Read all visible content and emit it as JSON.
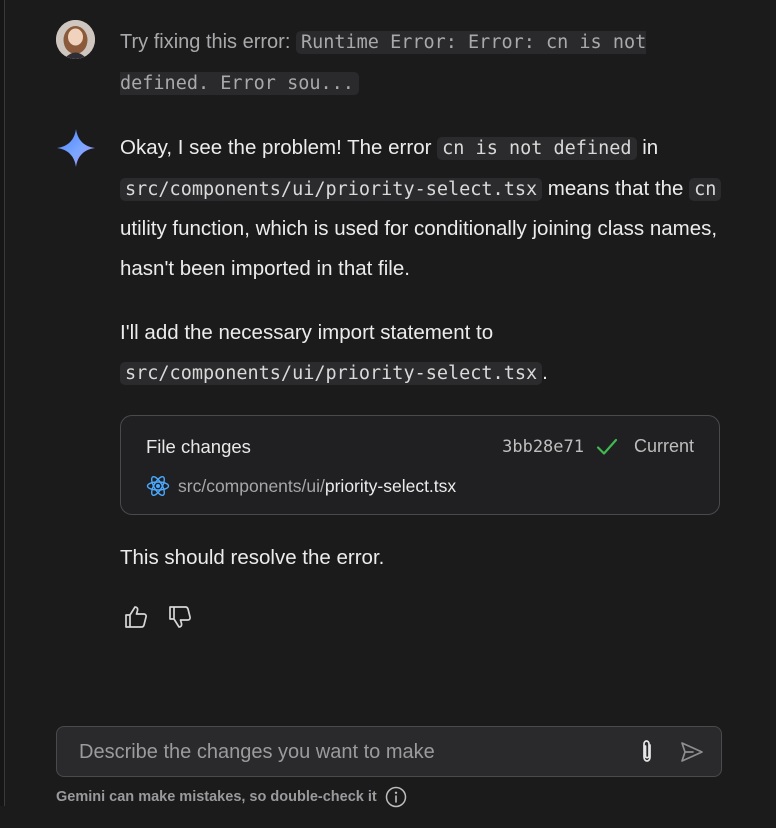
{
  "user_message": {
    "prefix": "Try fixing this error:",
    "code": "Runtime Error: Error: cn is not defined. Error sou..."
  },
  "assistant": {
    "p1": {
      "t1": "Okay, I see the problem! The error ",
      "c1": "cn is not defined",
      "t2": " in ",
      "c2": "src/components/ui/priority-select.tsx",
      "t3": " means that the ",
      "c3": "cn",
      "t4": " utility function, which is used for conditionally joining class names, hasn't been imported in that file."
    },
    "p2": {
      "t1": "I'll add the necessary import statement to ",
      "c1": "src/components/ui/priority-select.tsx",
      "t2": "."
    },
    "file_changes": {
      "title": "File changes",
      "hash": "3bb28e71",
      "status": "Current",
      "path_dir": "src/components/ui/",
      "path_name": "priority-select.tsx"
    },
    "closing": "This should resolve the error."
  },
  "composer": {
    "placeholder": "Describe the changes you want to make"
  },
  "disclaimer": "Gemini can make mistakes, so double-check it",
  "icons": {
    "avatar": "user-avatar",
    "spark": "gemini-spark-icon",
    "check": "check-icon",
    "react": "react-icon",
    "thumbs_up": "thumbs-up-icon",
    "thumbs_down": "thumbs-down-icon",
    "attach": "paperclip-icon",
    "send": "send-icon",
    "info": "info-icon"
  },
  "colors": {
    "background": "#1b1b1c",
    "check_green": "#3fb950",
    "react_blue": "#4aa8ff"
  }
}
